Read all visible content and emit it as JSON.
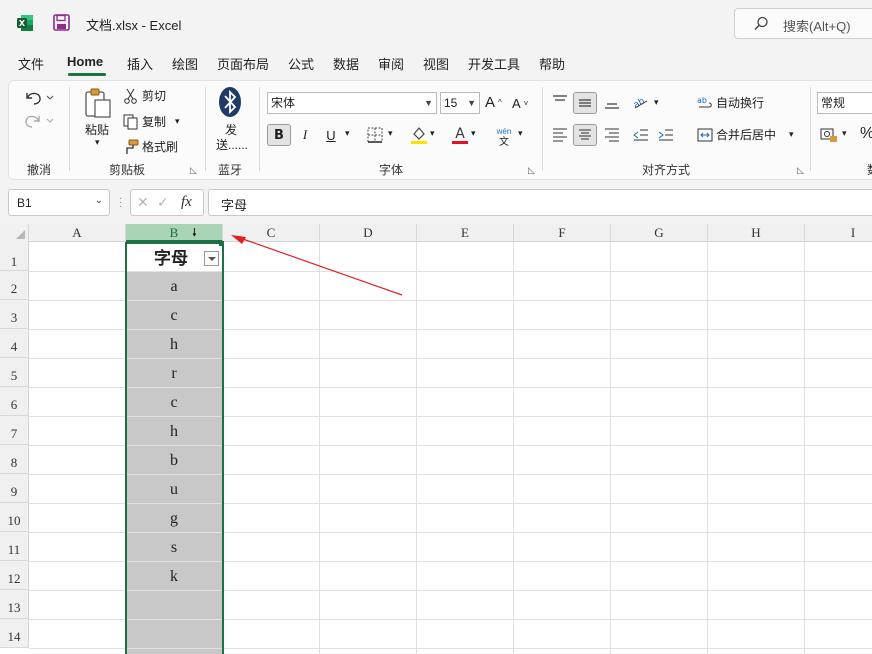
{
  "window": {
    "doc_title": "文档.xlsx  -  Excel",
    "search_placeholder": "搜索(Alt+Q)"
  },
  "menu": {
    "tabs": [
      "文件",
      "Home",
      "插入",
      "绘图",
      "页面布局",
      "公式",
      "数据",
      "审阅",
      "视图",
      "开发工具",
      "帮助"
    ],
    "active": "Home"
  },
  "ribbon": {
    "undo_group": "撤消",
    "clipboard": {
      "paste": "粘贴",
      "cut": "剪切",
      "copy": "复制",
      "format_painter": "格式刷",
      "group": "剪贴板"
    },
    "bluetooth": {
      "send_line1": "发",
      "send_line2": "送......",
      "group": "蓝牙"
    },
    "font": {
      "name": "宋体",
      "size": "15",
      "bold": "B",
      "italic": "I",
      "underline": "U",
      "phonetic": "wén",
      "phonetic_sub": "文",
      "group": "字体",
      "fill_color": "#ffe100",
      "font_color": "#e81123"
    },
    "alignment": {
      "wrap_text": "自动换行",
      "merge_center": "合并后居中",
      "group": "对齐方式"
    },
    "number": {
      "format": "常规",
      "percent": "%",
      "group_partial": "数"
    }
  },
  "formula_bar": {
    "name_box": "B1",
    "fx": "fx",
    "content": "字母"
  },
  "sheet": {
    "columns": [
      "A",
      "B",
      "C",
      "D",
      "E",
      "F",
      "G",
      "H",
      "I"
    ],
    "selected_column": "B",
    "rows": [
      "1",
      "2",
      "3",
      "4",
      "5",
      "6",
      "7",
      "8",
      "9",
      "10",
      "11",
      "12",
      "13",
      "14"
    ],
    "column_b": {
      "header": "字母",
      "values": [
        "a",
        "c",
        "h",
        "r",
        "c",
        "h",
        "b",
        "u",
        "g",
        "s",
        "k"
      ]
    },
    "accent_color": "#1e7145",
    "annotation_color": "#e02020"
  }
}
